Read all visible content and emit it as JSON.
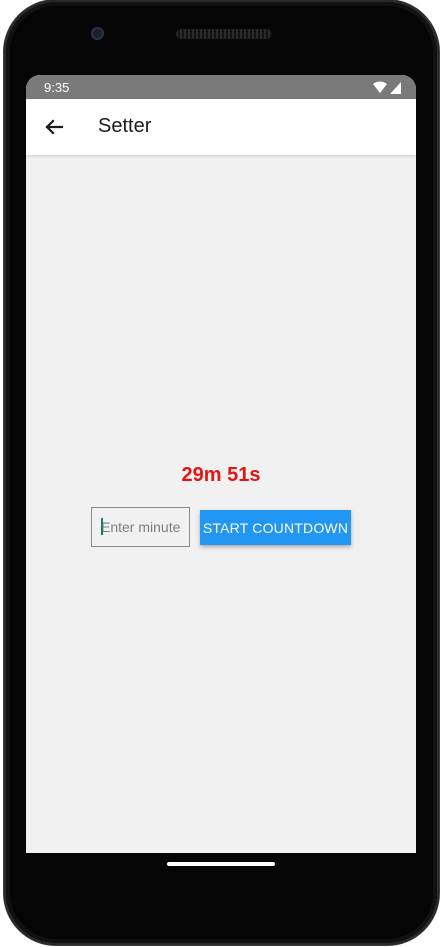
{
  "status_bar": {
    "time": "9:35",
    "icons": [
      "wifi-icon",
      "signal-icon"
    ]
  },
  "app_bar": {
    "title": "Setter",
    "back_icon": "arrow-back-icon"
  },
  "timer": {
    "countdown_text": "29m 51s",
    "color": "#e41414"
  },
  "form": {
    "minute_input": {
      "placeholder": "Enter minute",
      "value": ""
    },
    "start_button_label": "START COUNTDOWN",
    "accent": "#2196f3"
  }
}
